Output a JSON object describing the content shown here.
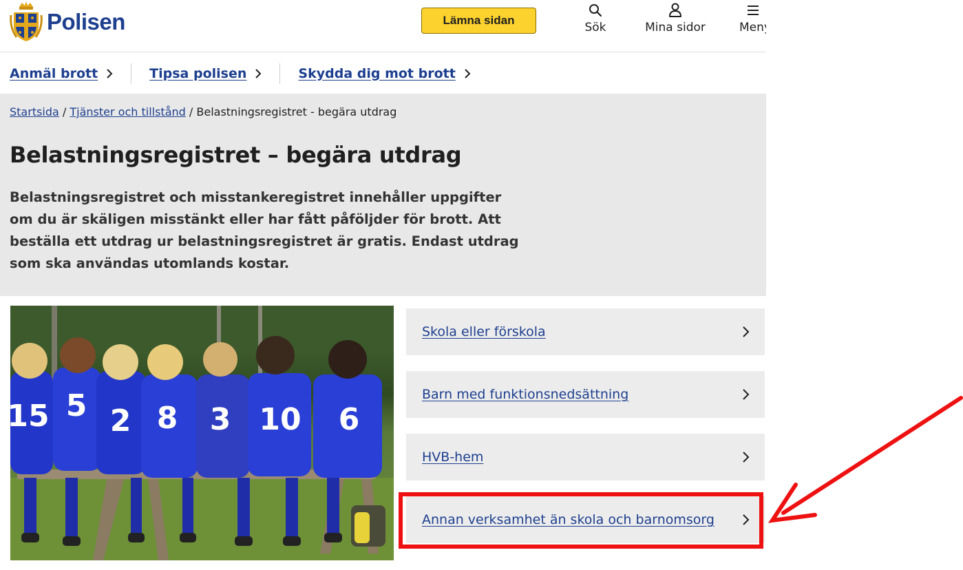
{
  "header": {
    "logo_text": "Polisen",
    "leave_button": "Lämna sidan",
    "search_label": "Sök",
    "my_pages_label": "Mina sidor",
    "menu_label": "Meny"
  },
  "quick_nav": [
    {
      "label": "Anmäl brott"
    },
    {
      "label": "Tipsa polisen"
    },
    {
      "label": "Skydda dig mot brott"
    }
  ],
  "breadcrumb": {
    "home": "Startsida",
    "sep1": " / ",
    "section": "Tjänster och tillstånd",
    "sep2": " / ",
    "current": "Belastningsregistret - begära utdrag"
  },
  "page": {
    "title": "Belastningsregistret – begära utdrag",
    "lead": "Belastningsregistret och misstankeregistret innehåller uppgifter om du är skäligen misstänkt eller har fått påföljder för brott. Att beställa ett utdrag ur belastningsregistret är gratis. Endast utdrag som ska användas utomlands kostar."
  },
  "photo": {
    "jersey_numbers": [
      "15",
      "5",
      "2",
      "8",
      "3",
      "10",
      "6"
    ]
  },
  "links": [
    {
      "label": "Skola eller förskola"
    },
    {
      "label": "Barn med funktionsnedsättning"
    },
    {
      "label": "HVB-hem"
    },
    {
      "label": "Annan verksamhet än skola och barnomsorg"
    }
  ],
  "colors": {
    "brand_blue": "#1d3f8f",
    "leave_button_yellow": "#fcd22e",
    "hero_grey": "#e8e8e8",
    "card_grey": "#ececec",
    "annotation_red": "#ee1111"
  }
}
